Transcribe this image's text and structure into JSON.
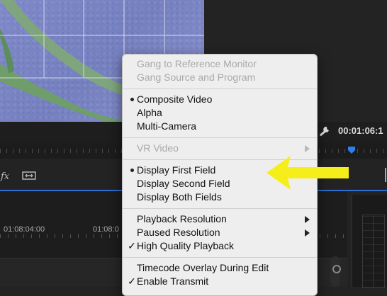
{
  "program_monitor": {
    "timecode": "00:01:06:1"
  },
  "timeline": {
    "ruler_labels": [
      "01:08:04:00",
      "01:08:0"
    ]
  },
  "menu": {
    "groups": [
      [
        {
          "label": "Gang to Reference Monitor",
          "enabled": false,
          "mark": "",
          "submenu": false
        },
        {
          "label": "Gang Source and Program",
          "enabled": false,
          "mark": "",
          "submenu": false
        }
      ],
      [
        {
          "label": "Composite Video",
          "enabled": true,
          "mark": "bullet",
          "submenu": false
        },
        {
          "label": "Alpha",
          "enabled": true,
          "mark": "",
          "submenu": false
        },
        {
          "label": "Multi-Camera",
          "enabled": true,
          "mark": "",
          "submenu": false
        }
      ],
      [
        {
          "label": "VR Video",
          "enabled": false,
          "mark": "",
          "submenu": true
        }
      ],
      [
        {
          "label": "Display First Field",
          "enabled": true,
          "mark": "bullet",
          "submenu": false
        },
        {
          "label": "Display Second Field",
          "enabled": true,
          "mark": "",
          "submenu": false
        },
        {
          "label": "Display Both Fields",
          "enabled": true,
          "mark": "",
          "submenu": false
        }
      ],
      [
        {
          "label": "Playback Resolution",
          "enabled": true,
          "mark": "",
          "submenu": true
        },
        {
          "label": "Paused Resolution",
          "enabled": true,
          "mark": "",
          "submenu": true
        },
        {
          "label": "High Quality Playback",
          "enabled": true,
          "mark": "check",
          "submenu": false
        }
      ],
      [
        {
          "label": "Timecode Overlay During Edit",
          "enabled": true,
          "mark": "",
          "submenu": false
        },
        {
          "label": "Enable Transmit",
          "enabled": true,
          "mark": "check",
          "submenu": false
        }
      ]
    ]
  },
  "colors": {
    "annotation_arrow": "#f5ee1a",
    "playhead": "#2d7ff0",
    "menu_background": "#eeeeee"
  }
}
